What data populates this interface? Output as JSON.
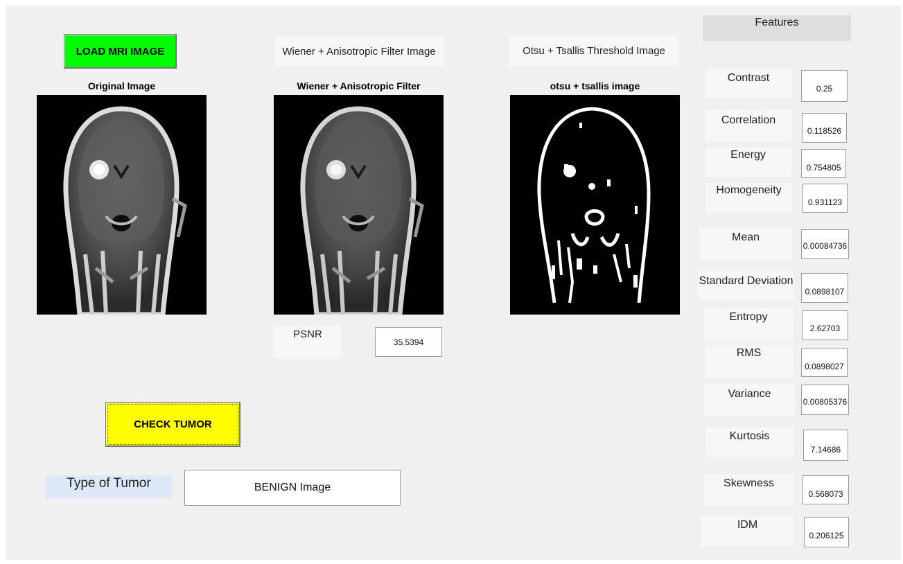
{
  "buttons": {
    "load": "LOAD MRI IMAGE",
    "check": "CHECK TUMOR"
  },
  "panels": {
    "wiener_label": "Wiener + Anisotropic Filter Image",
    "otsu_label": "Otsu + Tsallis Threshold Image",
    "original_title": "Original Image",
    "wiener_title": "Wiener + Anisotropic Filter",
    "otsu_title": "otsu + tsallis image"
  },
  "psnr": {
    "label": "PSNR",
    "value": "35.5394"
  },
  "tumor": {
    "label": "Type of Tumor",
    "value": "BENIGN Image"
  },
  "features": {
    "header": "Features",
    "items": [
      {
        "name": "Contrast",
        "value": "0.25"
      },
      {
        "name": "Correlation",
        "value": "0.118526"
      },
      {
        "name": "Energy",
        "value": "0.754805"
      },
      {
        "name": "Homogeneity",
        "value": "0.931123"
      },
      {
        "name": "Mean",
        "value": "0.00084736"
      },
      {
        "name": "Standard Deviation",
        "value": "0.0898107"
      },
      {
        "name": "Entropy",
        "value": "2.62703"
      },
      {
        "name": "RMS",
        "value": "0.0898027"
      },
      {
        "name": "Variance",
        "value": "0.00805376"
      },
      {
        "name": "Kurtosis",
        "value": "7.14686"
      },
      {
        "name": "Skewness",
        "value": "0.568073"
      },
      {
        "name": "IDM",
        "value": "0.206125"
      }
    ]
  },
  "colors": {
    "load_button": "#00ff00",
    "check_button": "#ffff00",
    "tumor_label_bg": "#dde8f8",
    "figure_bg": "#f0f0f0"
  }
}
